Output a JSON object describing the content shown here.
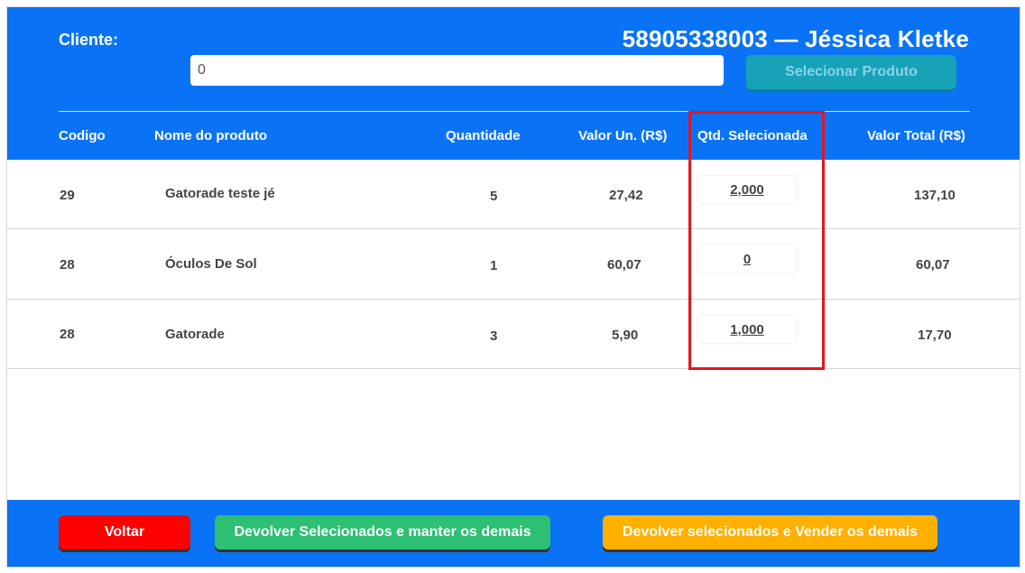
{
  "header": {
    "cliente_label": "Cliente:",
    "cliente_name": "58905338003 — Jéssica Kletke",
    "search_value": "0",
    "select_button": "Selecionar Produto"
  },
  "table": {
    "columns": {
      "codigo": "Codigo",
      "nome": "Nome do produto",
      "quantidade": "Quantidade",
      "valor_un": "Valor Un. (R$)",
      "qtd_sel": "Qtd. Selecionada",
      "valor_total": "Valor Total (R$)"
    },
    "rows": [
      {
        "codigo": "29",
        "nome": "Gatorade teste jé",
        "quantidade": "5",
        "valor_un": "27,42",
        "qtd_sel": "2,000",
        "valor_total": "137,10"
      },
      {
        "codigo": "28",
        "nome": "Óculos De Sol",
        "quantidade": "1",
        "valor_un": "60,07",
        "qtd_sel": "0",
        "valor_total": "60,07"
      },
      {
        "codigo": "28",
        "nome": "Gatorade",
        "quantidade": "3",
        "valor_un": "5,90",
        "qtd_sel": "1,000",
        "valor_total": "17,70"
      }
    ]
  },
  "footer": {
    "voltar": "Voltar",
    "devolver_manter": "Devolver Selecionados e manter os demais",
    "devolver_vender": "Devolver selecionados e Vender os demais"
  },
  "colors": {
    "primary_blue": "#0a73f5",
    "voltar_red": "#ff0000",
    "manter_green": "#2dbf73",
    "vender_orange": "#ffb000",
    "select_teal": "#17a2b8",
    "highlight_red": "#e8131b"
  }
}
